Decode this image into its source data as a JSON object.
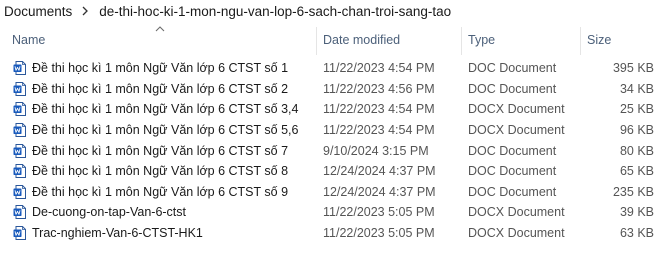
{
  "breadcrumb": {
    "items": [
      "Documents",
      "de-thi-hoc-ki-1-mon-ngu-van-lop-6-sach-chan-troi-sang-tao"
    ],
    "separator_icon": "chevron-right-icon"
  },
  "columns": {
    "name": "Name",
    "date_modified": "Date modified",
    "type": "Type",
    "size": "Size",
    "sort_indicator_icon": "sort-up-caret-icon"
  },
  "files": [
    {
      "name": "Đề thi học kì 1 môn Ngữ Văn lớp 6 CTST số 1",
      "date": "11/22/2023 4:54 PM",
      "type": "DOC Document",
      "size": "395 KB",
      "icon": "word-document-icon"
    },
    {
      "name": "Đề thi học kì 1 môn Ngữ Văn lớp 6 CTST số 2",
      "date": "11/22/2023 4:56 PM",
      "type": "DOC Document",
      "size": "34 KB",
      "icon": "word-document-icon"
    },
    {
      "name": "Đề thi học kì 1 môn Ngữ Văn lớp 6 CTST số 3,4",
      "date": "11/22/2023 4:54 PM",
      "type": "DOCX Document",
      "size": "25 KB",
      "icon": "word-document-icon"
    },
    {
      "name": "Đề thi học kì 1 môn Ngữ Văn lớp 6 CTST số 5,6",
      "date": "11/22/2023 4:54 PM",
      "type": "DOCX Document",
      "size": "96 KB",
      "icon": "word-document-icon"
    },
    {
      "name": "Đề thi học kì 1 môn Ngữ Văn lớp 6 CTST số 7",
      "date": "9/10/2024 3:15 PM",
      "type": "DOC Document",
      "size": "80 KB",
      "icon": "word-document-icon"
    },
    {
      "name": "Đề thi học kì 1 môn Ngữ Văn lớp 6 CTST số 8",
      "date": "12/24/2024 4:37 PM",
      "type": "DOC Document",
      "size": "65 KB",
      "icon": "word-document-icon"
    },
    {
      "name": "Đề thi học kì 1 môn Ngữ Văn lớp 6 CTST số 9",
      "date": "12/24/2024 4:37 PM",
      "type": "DOC Document",
      "size": "235 KB",
      "icon": "word-document-icon"
    },
    {
      "name": "De-cuong-on-tap-Van-6-ctst",
      "date": "11/22/2023 5:05 PM",
      "type": "DOCX Document",
      "size": "39 KB",
      "icon": "word-document-icon"
    },
    {
      "name": "Trac-nghiem-Van-6-CTST-HK1",
      "date": "11/22/2023 5:05 PM",
      "type": "DOCX Document",
      "size": "63 KB",
      "icon": "word-document-icon"
    }
  ],
  "colors": {
    "header_text": "#4c607a",
    "word_blue": "#185abd",
    "word_blue_light": "#41a5ee"
  }
}
